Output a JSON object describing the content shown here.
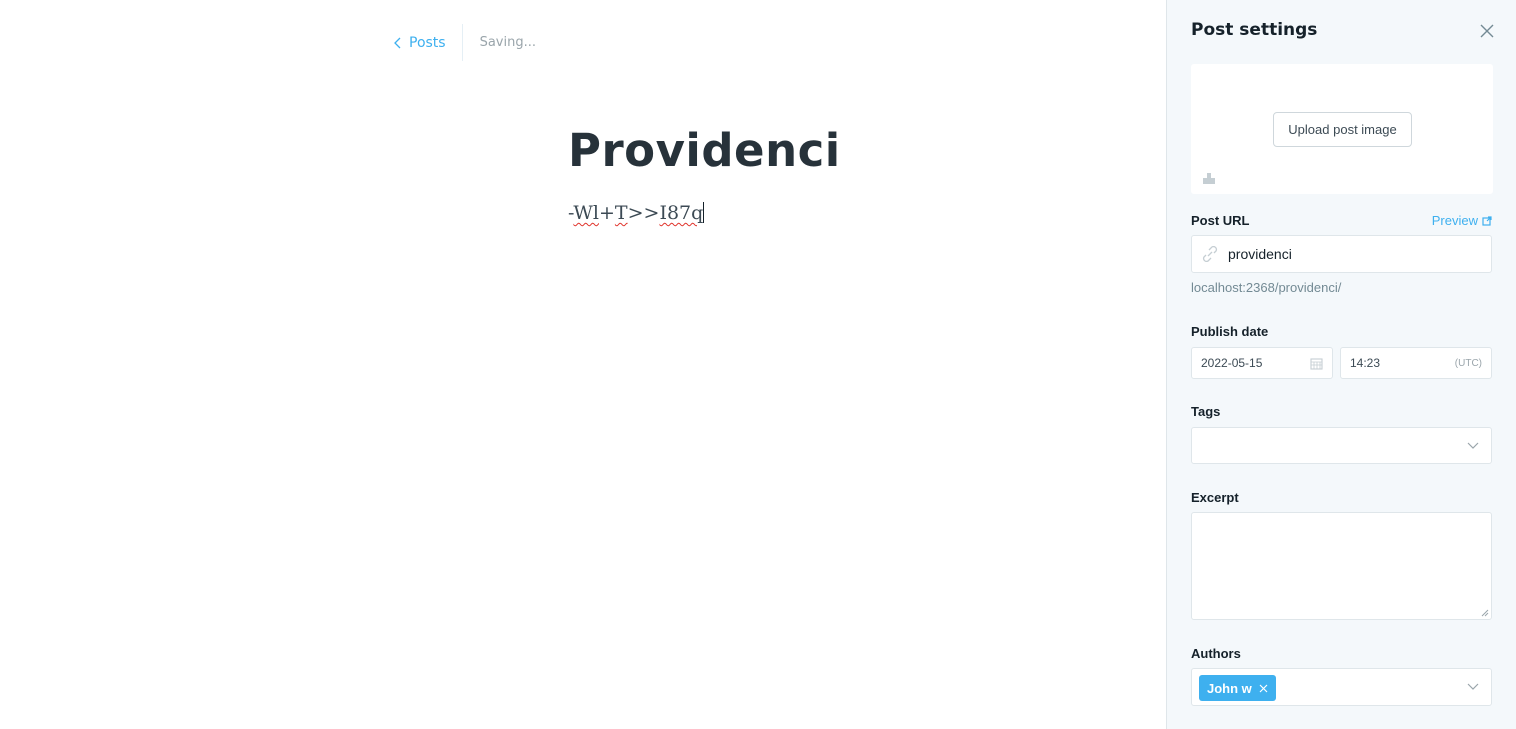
{
  "editor": {
    "back_label": "Posts",
    "status": "Saving...",
    "title": "Providenci",
    "body_segments": [
      "-",
      "Wl",
      "+",
      "T",
      ">>",
      "I87q"
    ]
  },
  "sidebar": {
    "title": "Post settings",
    "upload_label": "Upload post image",
    "post_url_label": "Post URL",
    "preview_label": "Preview",
    "slug": "providenci",
    "url_hint": "localhost:2368/providenci/",
    "publish_date_label": "Publish date",
    "date": "2022-05-15",
    "time": "14:23",
    "timezone": "(UTC)",
    "tags_label": "Tags",
    "excerpt_label": "Excerpt",
    "authors_label": "Authors",
    "author": "John w"
  },
  "colors": {
    "accent": "#3eb0ef",
    "sidebar_bg": "#f4f8fb",
    "text": "#15212a"
  },
  "icons": [
    "chevron-left-icon",
    "close-icon",
    "image-icon",
    "link-icon",
    "external-link-icon",
    "calendar-icon",
    "chevron-down-icon",
    "resize-handle-icon"
  ]
}
